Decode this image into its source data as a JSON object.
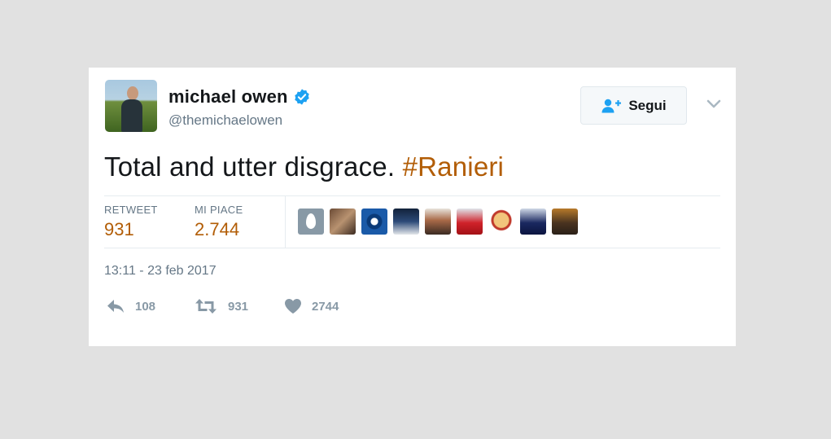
{
  "user": {
    "name": "michael owen",
    "handle": "@themichaelowen",
    "verified": true
  },
  "follow_button": {
    "label": "Segui",
    "icon": "follow-person-plus-icon"
  },
  "tweet": {
    "text": "Total and utter disgrace.",
    "hashtag": "#Ranieri"
  },
  "stats": {
    "retweet_label": "RETWEET",
    "retweet_value": "931",
    "likes_label": "MI PIACE",
    "likes_value": "2.744"
  },
  "timestamp": "13:11 - 23 feb 2017",
  "actions": {
    "reply_count": "108",
    "retweet_count": "931",
    "like_count": "2744"
  },
  "colors": {
    "accent": "#b25d06",
    "verified": "#1da1f2",
    "muted": "#657786",
    "background": "#e1e1e1"
  }
}
